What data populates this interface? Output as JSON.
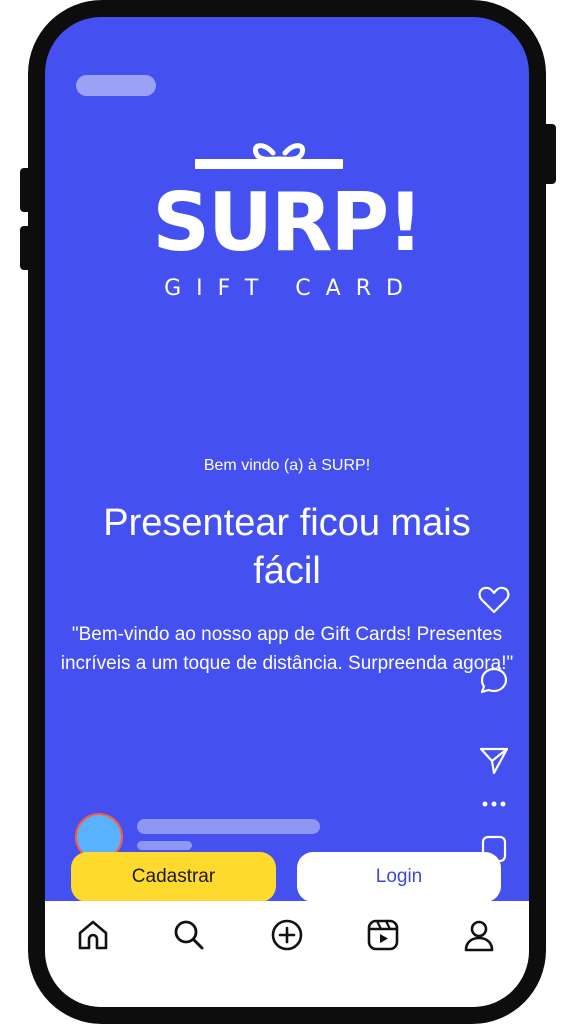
{
  "brand": {
    "logo_main": "SURP!",
    "logo_sub": "GIFT CARD",
    "colors": {
      "background": "#4450f0",
      "primary_button": "#ffda2e",
      "secondary_button": "#ffffff",
      "text": "#ffffff",
      "frame": "#0d0d0d"
    }
  },
  "content": {
    "welcome": "Bem vindo (a) à SURP!",
    "headline": "Presentear ficou mais fácil",
    "description": "\"Bem-vindo ao nosso app de Gift Cards! Presentes incríveis a um toque de distância. Surpreenda agora!\""
  },
  "actions": {
    "signup_label": "Cadastrar",
    "login_label": "Login"
  },
  "side_icons": [
    "heart-icon",
    "comment-icon",
    "send-icon",
    "more-icon",
    "save-icon"
  ],
  "bottom_nav": {
    "items": [
      {
        "icon": "home-icon"
      },
      {
        "icon": "search-icon"
      },
      {
        "icon": "add-icon"
      },
      {
        "icon": "reels-icon"
      },
      {
        "icon": "profile-icon"
      }
    ]
  }
}
